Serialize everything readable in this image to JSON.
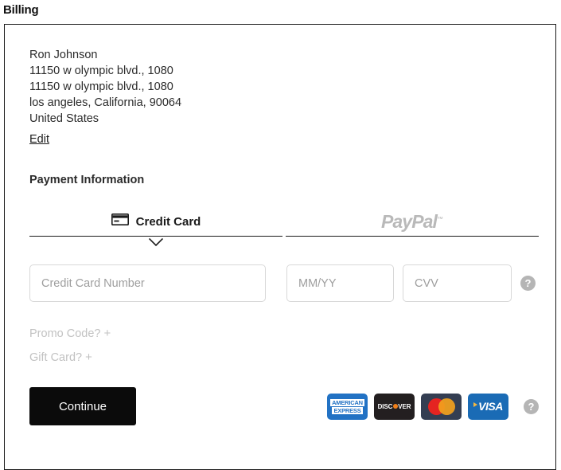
{
  "page": {
    "title": "Billing"
  },
  "address": {
    "lines": [
      "Ron Johnson",
      "11150 w olympic blvd., 1080",
      "11150 w olympic blvd., 1080",
      "los angeles, California, 90064",
      "United States"
    ],
    "edit_label": "Edit"
  },
  "payment": {
    "heading": "Payment Information",
    "tabs": [
      {
        "label": "Credit Card",
        "icon": "credit-card-icon",
        "active": true
      },
      {
        "label": "PayPal",
        "trademark": "™",
        "icon": "paypal-logo",
        "active": false
      }
    ],
    "fields": {
      "card_number": {
        "placeholder": "Credit Card Number",
        "value": ""
      },
      "expiry": {
        "placeholder": "MM/YY",
        "value": ""
      },
      "cvv": {
        "placeholder": "CVV",
        "value": ""
      }
    },
    "cvv_help": "?",
    "promo_label": "Promo Code?",
    "promo_plus": "+",
    "gift_label": "Gift Card?",
    "gift_plus": "+"
  },
  "footer": {
    "continue_label": "Continue",
    "brands": [
      {
        "name": "American Express",
        "line1": "AMERICAN",
        "line2": "EXPRESS",
        "color": "#2272c4"
      },
      {
        "name": "Discover",
        "text_before": "DISC",
        "text_after": "VER",
        "color": "#231f20"
      },
      {
        "name": "Mastercard",
        "color": "#343e52"
      },
      {
        "name": "Visa",
        "text": "VISA",
        "color": "#1a6bb5"
      }
    ],
    "brands_help": "?"
  },
  "colors": {
    "panel_border": "#1a1a1a",
    "input_border": "#d8d8d8",
    "placeholder": "#9e9e9e",
    "muted_link": "#c2c2c2",
    "button_bg": "#0b0b0b",
    "help_bg": "#b5b5b5",
    "paypal_gray": "#b9b9b9"
  }
}
